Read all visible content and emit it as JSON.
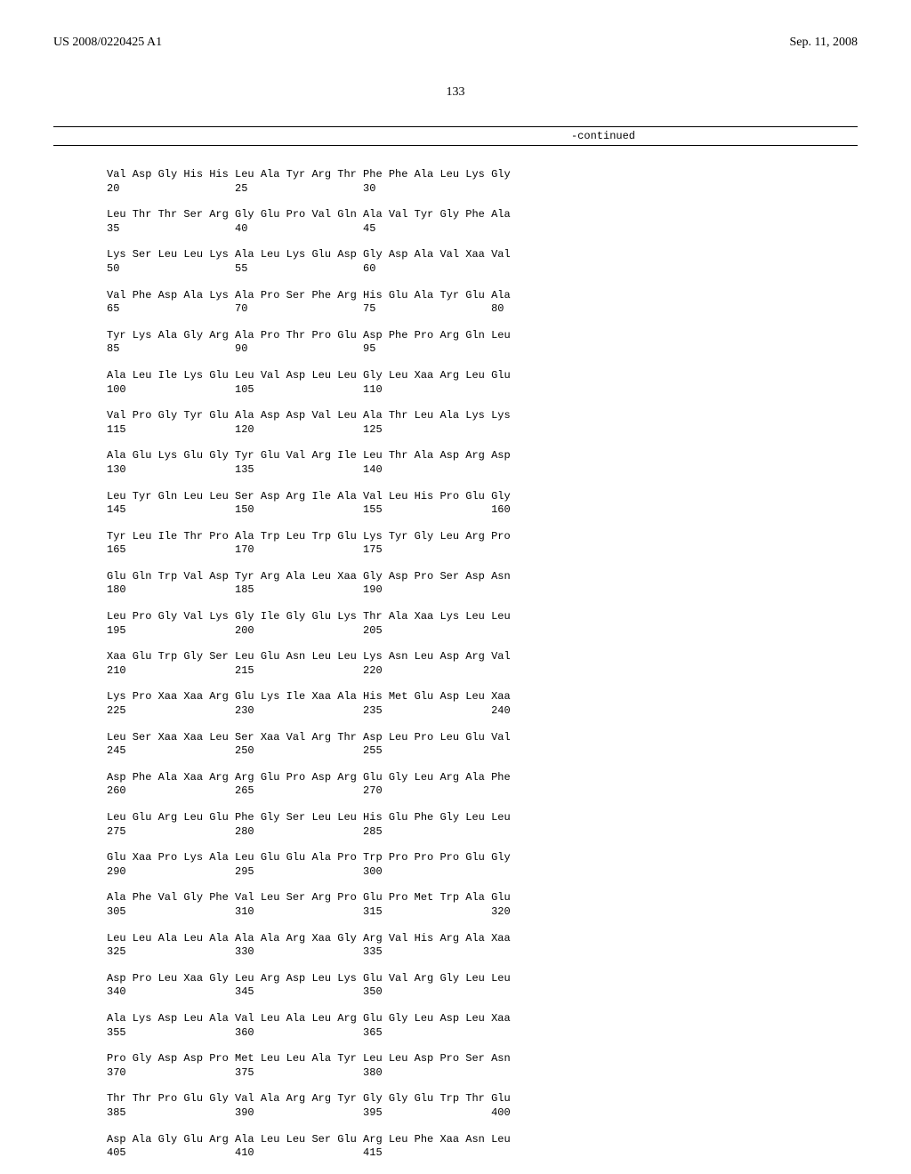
{
  "header": {
    "left": "US 2008/0220425 A1",
    "right": "Sep. 11, 2008"
  },
  "page_number": "133",
  "continued": "-continued",
  "sequence": [
    {
      "residues": "Val Asp Gly His His Leu Ala Tyr Arg Thr Phe Phe Ala Leu Lys Gly",
      "numbers": "20                  25                  30"
    },
    {
      "residues": "Leu Thr Thr Ser Arg Gly Glu Pro Val Gln Ala Val Tyr Gly Phe Ala",
      "numbers": "35                  40                  45"
    },
    {
      "residues": "Lys Ser Leu Leu Lys Ala Leu Lys Glu Asp Gly Asp Ala Val Xaa Val",
      "numbers": "50                  55                  60"
    },
    {
      "residues": "Val Phe Asp Ala Lys Ala Pro Ser Phe Arg His Glu Ala Tyr Glu Ala",
      "numbers": "65                  70                  75                  80"
    },
    {
      "residues": "Tyr Lys Ala Gly Arg Ala Pro Thr Pro Glu Asp Phe Pro Arg Gln Leu",
      "numbers": "85                  90                  95"
    },
    {
      "residues": "Ala Leu Ile Lys Glu Leu Val Asp Leu Leu Gly Leu Xaa Arg Leu Glu",
      "numbers": "100                 105                 110"
    },
    {
      "residues": "Val Pro Gly Tyr Glu Ala Asp Asp Val Leu Ala Thr Leu Ala Lys Lys",
      "numbers": "115                 120                 125"
    },
    {
      "residues": "Ala Glu Lys Glu Gly Tyr Glu Val Arg Ile Leu Thr Ala Asp Arg Asp",
      "numbers": "130                 135                 140"
    },
    {
      "residues": "Leu Tyr Gln Leu Leu Ser Asp Arg Ile Ala Val Leu His Pro Glu Gly",
      "numbers": "145                 150                 155                 160"
    },
    {
      "residues": "Tyr Leu Ile Thr Pro Ala Trp Leu Trp Glu Lys Tyr Gly Leu Arg Pro",
      "numbers": "165                 170                 175"
    },
    {
      "residues": "Glu Gln Trp Val Asp Tyr Arg Ala Leu Xaa Gly Asp Pro Ser Asp Asn",
      "numbers": "180                 185                 190"
    },
    {
      "residues": "Leu Pro Gly Val Lys Gly Ile Gly Glu Lys Thr Ala Xaa Lys Leu Leu",
      "numbers": "195                 200                 205"
    },
    {
      "residues": "Xaa Glu Trp Gly Ser Leu Glu Asn Leu Leu Lys Asn Leu Asp Arg Val",
      "numbers": "210                 215                 220"
    },
    {
      "residues": "Lys Pro Xaa Xaa Arg Glu Lys Ile Xaa Ala His Met Glu Asp Leu Xaa",
      "numbers": "225                 230                 235                 240"
    },
    {
      "residues": "Leu Ser Xaa Xaa Leu Ser Xaa Val Arg Thr Asp Leu Pro Leu Glu Val",
      "numbers": "245                 250                 255"
    },
    {
      "residues": "Asp Phe Ala Xaa Arg Arg Glu Pro Asp Arg Glu Gly Leu Arg Ala Phe",
      "numbers": "260                 265                 270"
    },
    {
      "residues": "Leu Glu Arg Leu Glu Phe Gly Ser Leu Leu His Glu Phe Gly Leu Leu",
      "numbers": "275                 280                 285"
    },
    {
      "residues": "Glu Xaa Pro Lys Ala Leu Glu Glu Ala Pro Trp Pro Pro Pro Glu Gly",
      "numbers": "290                 295                 300"
    },
    {
      "residues": "Ala Phe Val Gly Phe Val Leu Ser Arg Pro Glu Pro Met Trp Ala Glu",
      "numbers": "305                 310                 315                 320"
    },
    {
      "residues": "Leu Leu Ala Leu Ala Ala Ala Arg Xaa Gly Arg Val His Arg Ala Xaa",
      "numbers": "325                 330                 335"
    },
    {
      "residues": "Asp Pro Leu Xaa Gly Leu Arg Asp Leu Lys Glu Val Arg Gly Leu Leu",
      "numbers": "340                 345                 350"
    },
    {
      "residues": "Ala Lys Asp Leu Ala Val Leu Ala Leu Arg Glu Gly Leu Asp Leu Xaa",
      "numbers": "355                 360                 365"
    },
    {
      "residues": "Pro Gly Asp Asp Pro Met Leu Leu Ala Tyr Leu Leu Asp Pro Ser Asn",
      "numbers": "370                 375                 380"
    },
    {
      "residues": "Thr Thr Pro Glu Gly Val Ala Arg Arg Tyr Gly Gly Glu Trp Thr Glu",
      "numbers": "385                 390                 395                 400"
    },
    {
      "residues": "Asp Ala Gly Glu Arg Ala Leu Leu Ser Glu Arg Leu Phe Xaa Asn Leu",
      "numbers": "405                 410                 415"
    }
  ]
}
